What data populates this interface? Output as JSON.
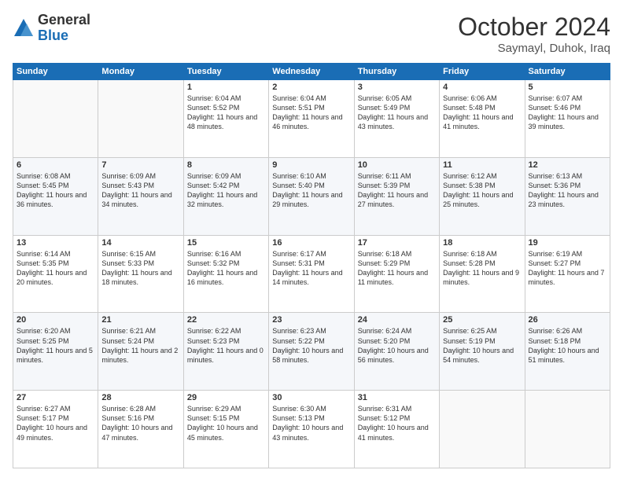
{
  "header": {
    "logo_general": "General",
    "logo_blue": "Blue",
    "month_title": "October 2024",
    "location": "Saymayl, Duhok, Iraq"
  },
  "weekdays": [
    "Sunday",
    "Monday",
    "Tuesday",
    "Wednesday",
    "Thursday",
    "Friday",
    "Saturday"
  ],
  "weeks": [
    [
      {
        "day": "",
        "sunrise": "",
        "sunset": "",
        "daylight": ""
      },
      {
        "day": "",
        "sunrise": "",
        "sunset": "",
        "daylight": ""
      },
      {
        "day": "1",
        "sunrise": "Sunrise: 6:04 AM",
        "sunset": "Sunset: 5:52 PM",
        "daylight": "Daylight: 11 hours and 48 minutes."
      },
      {
        "day": "2",
        "sunrise": "Sunrise: 6:04 AM",
        "sunset": "Sunset: 5:51 PM",
        "daylight": "Daylight: 11 hours and 46 minutes."
      },
      {
        "day": "3",
        "sunrise": "Sunrise: 6:05 AM",
        "sunset": "Sunset: 5:49 PM",
        "daylight": "Daylight: 11 hours and 43 minutes."
      },
      {
        "day": "4",
        "sunrise": "Sunrise: 6:06 AM",
        "sunset": "Sunset: 5:48 PM",
        "daylight": "Daylight: 11 hours and 41 minutes."
      },
      {
        "day": "5",
        "sunrise": "Sunrise: 6:07 AM",
        "sunset": "Sunset: 5:46 PM",
        "daylight": "Daylight: 11 hours and 39 minutes."
      }
    ],
    [
      {
        "day": "6",
        "sunrise": "Sunrise: 6:08 AM",
        "sunset": "Sunset: 5:45 PM",
        "daylight": "Daylight: 11 hours and 36 minutes."
      },
      {
        "day": "7",
        "sunrise": "Sunrise: 6:09 AM",
        "sunset": "Sunset: 5:43 PM",
        "daylight": "Daylight: 11 hours and 34 minutes."
      },
      {
        "day": "8",
        "sunrise": "Sunrise: 6:09 AM",
        "sunset": "Sunset: 5:42 PM",
        "daylight": "Daylight: 11 hours and 32 minutes."
      },
      {
        "day": "9",
        "sunrise": "Sunrise: 6:10 AM",
        "sunset": "Sunset: 5:40 PM",
        "daylight": "Daylight: 11 hours and 29 minutes."
      },
      {
        "day": "10",
        "sunrise": "Sunrise: 6:11 AM",
        "sunset": "Sunset: 5:39 PM",
        "daylight": "Daylight: 11 hours and 27 minutes."
      },
      {
        "day": "11",
        "sunrise": "Sunrise: 6:12 AM",
        "sunset": "Sunset: 5:38 PM",
        "daylight": "Daylight: 11 hours and 25 minutes."
      },
      {
        "day": "12",
        "sunrise": "Sunrise: 6:13 AM",
        "sunset": "Sunset: 5:36 PM",
        "daylight": "Daylight: 11 hours and 23 minutes."
      }
    ],
    [
      {
        "day": "13",
        "sunrise": "Sunrise: 6:14 AM",
        "sunset": "Sunset: 5:35 PM",
        "daylight": "Daylight: 11 hours and 20 minutes."
      },
      {
        "day": "14",
        "sunrise": "Sunrise: 6:15 AM",
        "sunset": "Sunset: 5:33 PM",
        "daylight": "Daylight: 11 hours and 18 minutes."
      },
      {
        "day": "15",
        "sunrise": "Sunrise: 6:16 AM",
        "sunset": "Sunset: 5:32 PM",
        "daylight": "Daylight: 11 hours and 16 minutes."
      },
      {
        "day": "16",
        "sunrise": "Sunrise: 6:17 AM",
        "sunset": "Sunset: 5:31 PM",
        "daylight": "Daylight: 11 hours and 14 minutes."
      },
      {
        "day": "17",
        "sunrise": "Sunrise: 6:18 AM",
        "sunset": "Sunset: 5:29 PM",
        "daylight": "Daylight: 11 hours and 11 minutes."
      },
      {
        "day": "18",
        "sunrise": "Sunrise: 6:18 AM",
        "sunset": "Sunset: 5:28 PM",
        "daylight": "Daylight: 11 hours and 9 minutes."
      },
      {
        "day": "19",
        "sunrise": "Sunrise: 6:19 AM",
        "sunset": "Sunset: 5:27 PM",
        "daylight": "Daylight: 11 hours and 7 minutes."
      }
    ],
    [
      {
        "day": "20",
        "sunrise": "Sunrise: 6:20 AM",
        "sunset": "Sunset: 5:25 PM",
        "daylight": "Daylight: 11 hours and 5 minutes."
      },
      {
        "day": "21",
        "sunrise": "Sunrise: 6:21 AM",
        "sunset": "Sunset: 5:24 PM",
        "daylight": "Daylight: 11 hours and 2 minutes."
      },
      {
        "day": "22",
        "sunrise": "Sunrise: 6:22 AM",
        "sunset": "Sunset: 5:23 PM",
        "daylight": "Daylight: 11 hours and 0 minutes."
      },
      {
        "day": "23",
        "sunrise": "Sunrise: 6:23 AM",
        "sunset": "Sunset: 5:22 PM",
        "daylight": "Daylight: 10 hours and 58 minutes."
      },
      {
        "day": "24",
        "sunrise": "Sunrise: 6:24 AM",
        "sunset": "Sunset: 5:20 PM",
        "daylight": "Daylight: 10 hours and 56 minutes."
      },
      {
        "day": "25",
        "sunrise": "Sunrise: 6:25 AM",
        "sunset": "Sunset: 5:19 PM",
        "daylight": "Daylight: 10 hours and 54 minutes."
      },
      {
        "day": "26",
        "sunrise": "Sunrise: 6:26 AM",
        "sunset": "Sunset: 5:18 PM",
        "daylight": "Daylight: 10 hours and 51 minutes."
      }
    ],
    [
      {
        "day": "27",
        "sunrise": "Sunrise: 6:27 AM",
        "sunset": "Sunset: 5:17 PM",
        "daylight": "Daylight: 10 hours and 49 minutes."
      },
      {
        "day": "28",
        "sunrise": "Sunrise: 6:28 AM",
        "sunset": "Sunset: 5:16 PM",
        "daylight": "Daylight: 10 hours and 47 minutes."
      },
      {
        "day": "29",
        "sunrise": "Sunrise: 6:29 AM",
        "sunset": "Sunset: 5:15 PM",
        "daylight": "Daylight: 10 hours and 45 minutes."
      },
      {
        "day": "30",
        "sunrise": "Sunrise: 6:30 AM",
        "sunset": "Sunset: 5:13 PM",
        "daylight": "Daylight: 10 hours and 43 minutes."
      },
      {
        "day": "31",
        "sunrise": "Sunrise: 6:31 AM",
        "sunset": "Sunset: 5:12 PM",
        "daylight": "Daylight: 10 hours and 41 minutes."
      },
      {
        "day": "",
        "sunrise": "",
        "sunset": "",
        "daylight": ""
      },
      {
        "day": "",
        "sunrise": "",
        "sunset": "",
        "daylight": ""
      }
    ]
  ]
}
